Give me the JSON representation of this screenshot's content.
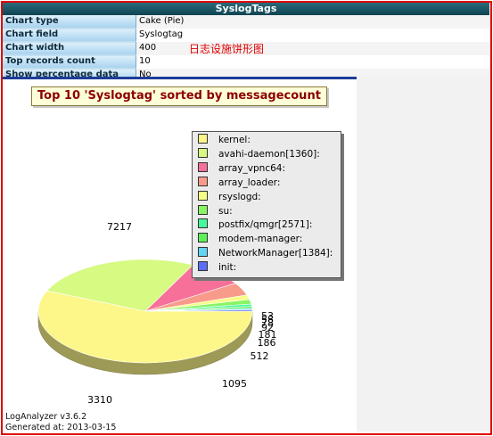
{
  "header": {
    "title": "SyslogTags"
  },
  "properties": [
    {
      "label": "Chart type",
      "value": "Cake (Pie)"
    },
    {
      "label": "Chart field",
      "value": "Syslogtag"
    },
    {
      "label": "Chart width",
      "value": "400"
    },
    {
      "label": "Top records count",
      "value": "10"
    },
    {
      "label": "Show percentage data",
      "value": "No"
    }
  ],
  "note": "日志设施饼形图",
  "chart_data": {
    "type": "pie",
    "title": "Top 10 'Syslogtag' sorted by messagecount",
    "categories": [
      "kernel:",
      "avahi-daemon[1360]:",
      "array_vpnc64:",
      "array_loader:",
      "rsyslogd:",
      "su:",
      "postfix/qmgr[2571]:",
      "modem-manager:",
      "NetworkManager[1384]:",
      "init:"
    ],
    "values": [
      7217,
      3310,
      1095,
      512,
      186,
      181,
      92,
      78,
      58,
      53
    ],
    "data_labels": [
      "7217",
      "3310",
      "1095",
      "512",
      "186",
      "181",
      "92",
      "78",
      "58",
      "53"
    ],
    "colors": [
      "#fdf78a",
      "#d6fa82",
      "#f6709a",
      "#f89b8a",
      "#f6fd86",
      "#88f464",
      "#43fa9c",
      "#5cf05a",
      "#64d4f4",
      "#5a6ef8"
    ],
    "legend_position": "top-right"
  },
  "footer": {
    "version": "LogAnalyzer v3.6.2",
    "generated": "Generated at: 2013-03-15"
  }
}
